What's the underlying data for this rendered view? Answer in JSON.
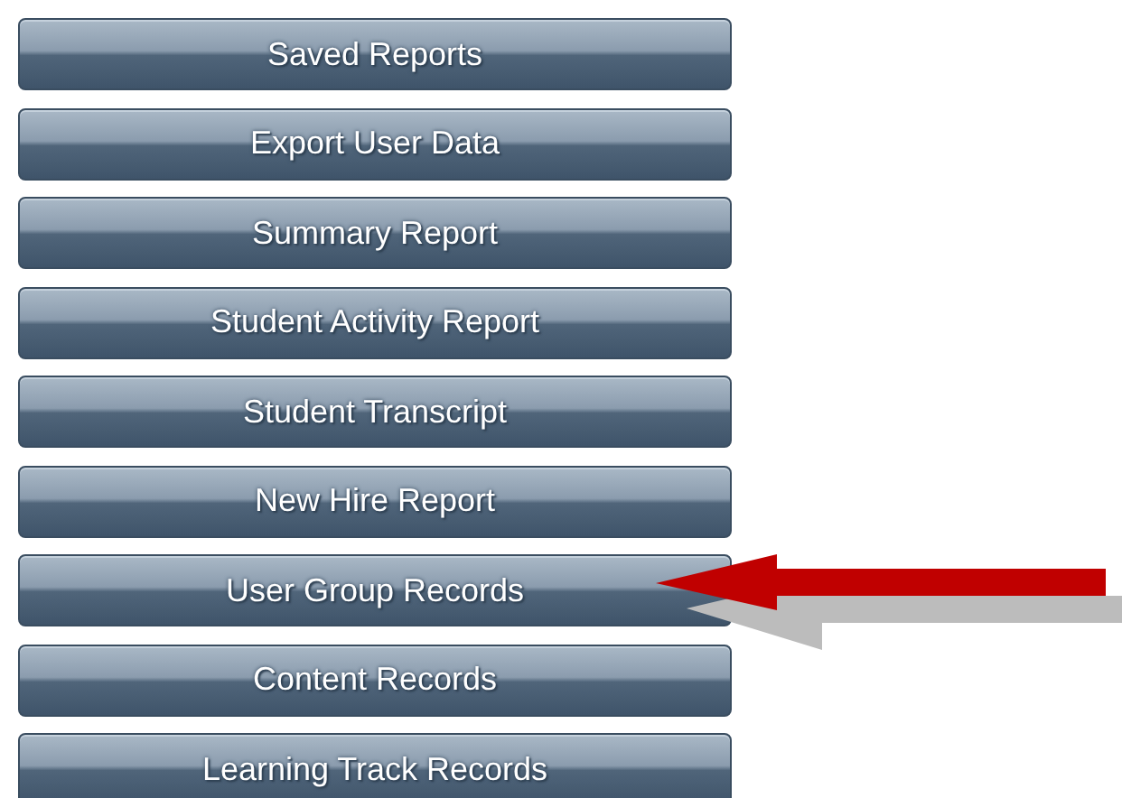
{
  "buttons": [
    {
      "label": "Saved Reports"
    },
    {
      "label": "Export User Data"
    },
    {
      "label": "Summary Report"
    },
    {
      "label": "Student Activity Report"
    },
    {
      "label": "Student Transcript"
    },
    {
      "label": "New Hire Report"
    },
    {
      "label": "User Group Records",
      "highlighted": true
    },
    {
      "label": "Content Records"
    },
    {
      "label": "Learning Track Records"
    }
  ]
}
